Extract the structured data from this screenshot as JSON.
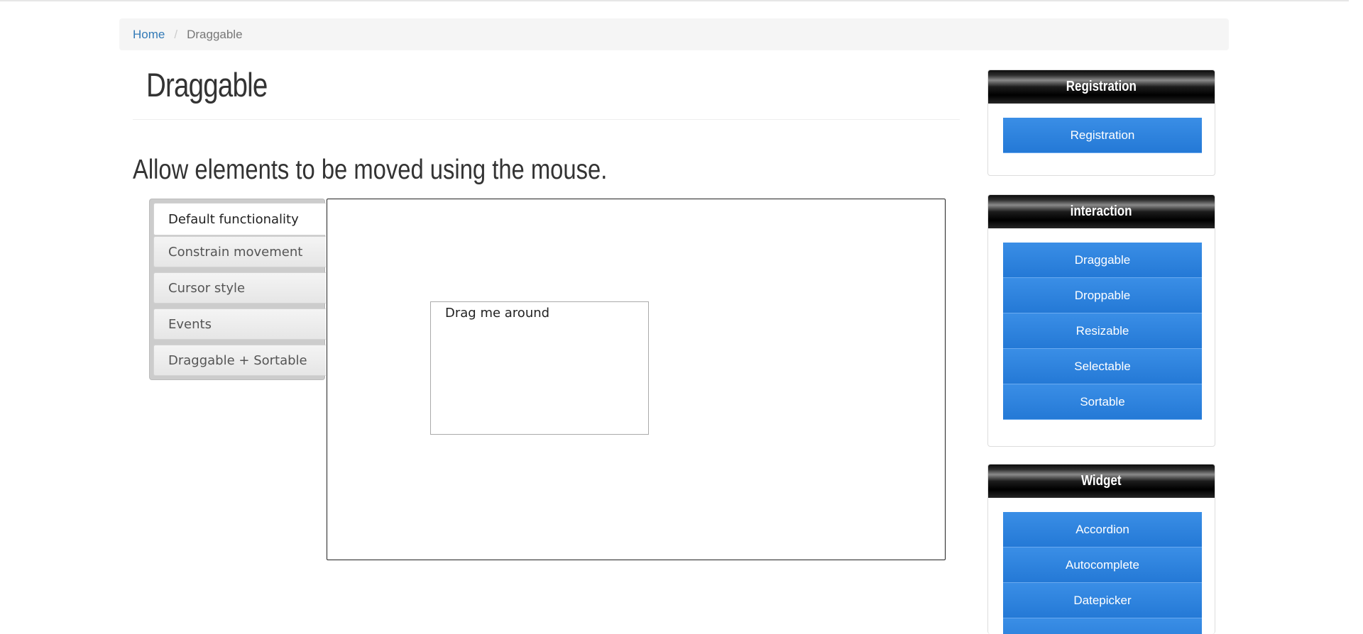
{
  "breadcrumb": {
    "home": "Home",
    "separator": "/",
    "current": "Draggable"
  },
  "page": {
    "title": "Draggable",
    "subtitle": "Allow elements to be moved using the mouse."
  },
  "tabs": [
    {
      "label": "Default functionality",
      "active": true
    },
    {
      "label": "Constrain movement",
      "active": false
    },
    {
      "label": "Cursor style",
      "active": false
    },
    {
      "label": "Events",
      "active": false
    },
    {
      "label": "Draggable + Sortable",
      "active": false
    }
  ],
  "demo": {
    "draggable_label": "Drag me around"
  },
  "sidebar": {
    "registration": {
      "heading": "Registration",
      "items": [
        "Registration"
      ]
    },
    "interaction": {
      "heading": "interaction",
      "items": [
        "Draggable",
        "Droppable",
        "Resizable",
        "Selectable",
        "Sortable"
      ]
    },
    "widget": {
      "heading": "Widget",
      "items": [
        "Accordion",
        "Autocomplete",
        "Datepicker"
      ]
    }
  },
  "colors": {
    "link": "#337ab7",
    "sidebar_button": "#2479d6",
    "panel_heading": "#000000"
  }
}
